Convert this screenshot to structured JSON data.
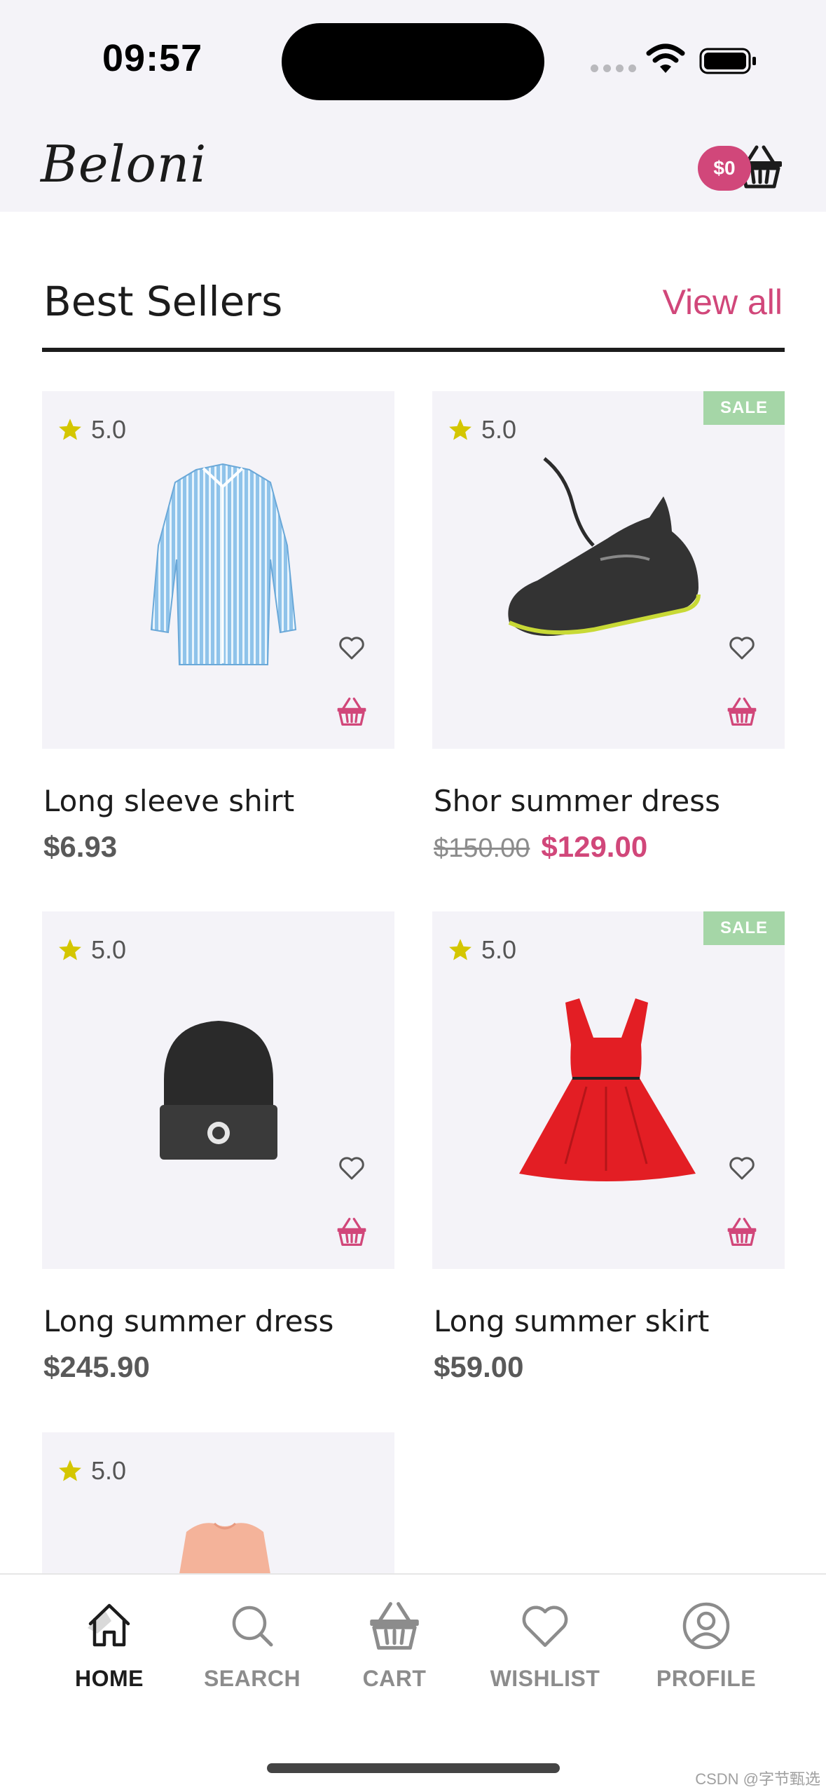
{
  "status_bar": {
    "time": "09:57"
  },
  "header": {
    "logo": "Beloni",
    "cart_total": "$0"
  },
  "section": {
    "title": "Best Sellers",
    "view_all": "View all"
  },
  "products": [
    {
      "name": "Long sleeve shirt",
      "rating": "5.0",
      "price": "$6.93",
      "old_price": null,
      "sale": false,
      "image": "blue-striped-shirt"
    },
    {
      "name": "Shor summer dress",
      "rating": "5.0",
      "price": "$129.00",
      "old_price": "$150.00",
      "sale": true,
      "sale_label": "SALE",
      "image": "black-sneaker"
    },
    {
      "name": "Long summer dress",
      "rating": "5.0",
      "price": "$245.90",
      "old_price": null,
      "sale": false,
      "image": "black-beanie"
    },
    {
      "name": "Long summer skirt",
      "rating": "5.0",
      "price": "$59.00",
      "old_price": null,
      "sale": true,
      "sale_label": "SALE",
      "image": "red-dress"
    },
    {
      "name": "",
      "rating": "5.0",
      "price": "",
      "old_price": null,
      "sale": false,
      "image": "peach-top"
    }
  ],
  "nav": {
    "items": [
      {
        "label": "HOME",
        "icon": "home-icon",
        "active": true
      },
      {
        "label": "SEARCH",
        "icon": "search-icon",
        "active": false
      },
      {
        "label": "CART",
        "icon": "basket-icon",
        "active": false
      },
      {
        "label": "WISHLIST",
        "icon": "heart-icon",
        "active": false
      },
      {
        "label": "PROFILE",
        "icon": "profile-icon",
        "active": false
      }
    ]
  },
  "watermark": "CSDN @字节甄选",
  "colors": {
    "accent": "#d1477a",
    "sale_badge": "#a5d6a7",
    "card_bg": "#f4f3f8",
    "star": "#d4c600"
  }
}
